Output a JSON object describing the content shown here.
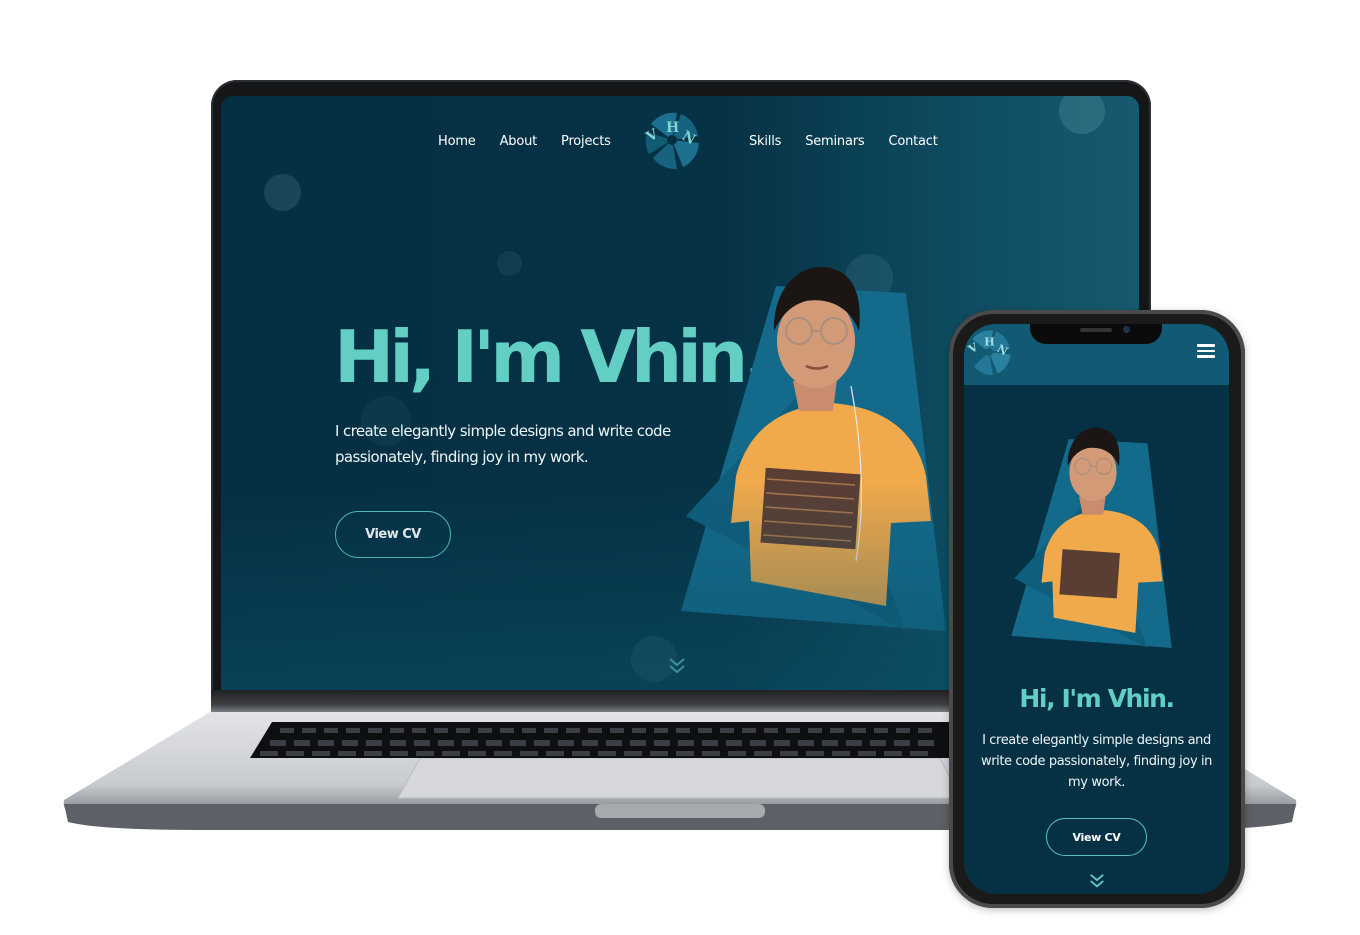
{
  "site": {
    "logo_letters": [
      "V",
      "H",
      "N"
    ],
    "nav_left": [
      "Home",
      "About",
      "Projects"
    ],
    "nav_right": [
      "Skills",
      "Seminars",
      "Contact"
    ],
    "hero": {
      "title": "Hi, I'm Vhin.",
      "description": "I create elegantly simple designs and write code passionately, finding joy in my work.",
      "cta_label": "View CV"
    },
    "icons": {
      "logo": "vhn-fan-logo",
      "scroll": "chevron-double-down-icon",
      "menu": "hamburger-menu-icon"
    }
  },
  "mobile": {
    "title": "Hi, I'm Vhin.",
    "description": "I create elegantly simple designs and write code passionately, finding joy in my work.",
    "cta_label": "View CV"
  },
  "colors": {
    "background": "#063246",
    "accent": "#62cec4",
    "shape": "#136a8a",
    "text": "#eef5f7"
  }
}
